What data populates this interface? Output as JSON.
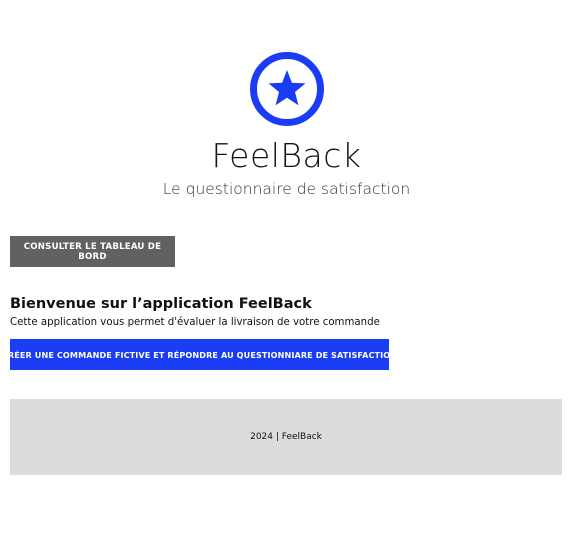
{
  "brand": {
    "name": "FeelBack",
    "tagline": "Le questionnaire de satisfaction",
    "logo_icon": "star-circle-icon",
    "logo_color": "#1a3cf5"
  },
  "toolbar": {
    "dashboard_label": "CONSULTER LE TABLEAU DE BORD"
  },
  "welcome": {
    "title": "Bienvenue sur l’application FeelBack",
    "description": "Cette application vous permet d'évaluer la livraison de votre commande",
    "create_label": "CRÉER UNE COMMANDE FICTIVE ET RÉPONDRE AU QUESTIONNIARE DE SATISFACTION"
  },
  "footer": {
    "text": "2024 | FeelBack"
  },
  "colors": {
    "accent": "#1a3cf5",
    "secondary_button": "#616161",
    "footer_bg": "#dcdcdc"
  }
}
